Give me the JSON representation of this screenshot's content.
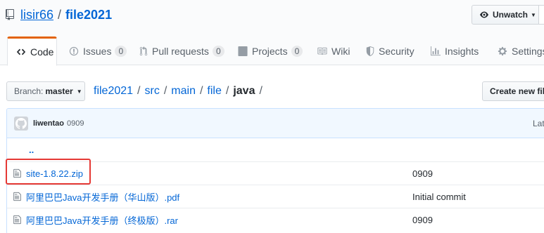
{
  "header": {
    "owner": "lisir66",
    "separator": "/",
    "repo": "file2021",
    "watch_label": "Unwatch"
  },
  "tabs": [
    {
      "label": "Code",
      "icon": "code-icon"
    },
    {
      "label": "Issues",
      "count": "0",
      "icon": "issue-icon"
    },
    {
      "label": "Pull requests",
      "count": "0",
      "icon": "pull-request-icon"
    },
    {
      "label": "Projects",
      "count": "0",
      "icon": "project-icon"
    },
    {
      "label": "Wiki",
      "icon": "book-icon"
    },
    {
      "label": "Security",
      "icon": "shield-icon"
    },
    {
      "label": "Insights",
      "icon": "graph-icon"
    },
    {
      "label": "Settings",
      "icon": "gear-icon"
    }
  ],
  "branch": {
    "label": "Branch:",
    "value": "master"
  },
  "breadcrumb": {
    "root": "file2021",
    "parts": [
      "src",
      "main",
      "file"
    ],
    "current": "java",
    "sep": "/"
  },
  "actions": {
    "create_file": "Create new file"
  },
  "commit": {
    "author": "liwentao",
    "message": "0909",
    "latest_label": "Lat"
  },
  "files": {
    "parent": "..",
    "rows": [
      {
        "name": "site-1.8.22.zip",
        "message": "0909"
      },
      {
        "name": "阿里巴巴Java开发手册（华山版）.pdf",
        "message": "Initial commit"
      },
      {
        "name": "阿里巴巴Java开发手册（终极版）.rar",
        "message": "0909"
      }
    ]
  },
  "colors": {
    "accent": "#0366d6",
    "active_tab": "#e36209",
    "highlight": "#e53935"
  }
}
